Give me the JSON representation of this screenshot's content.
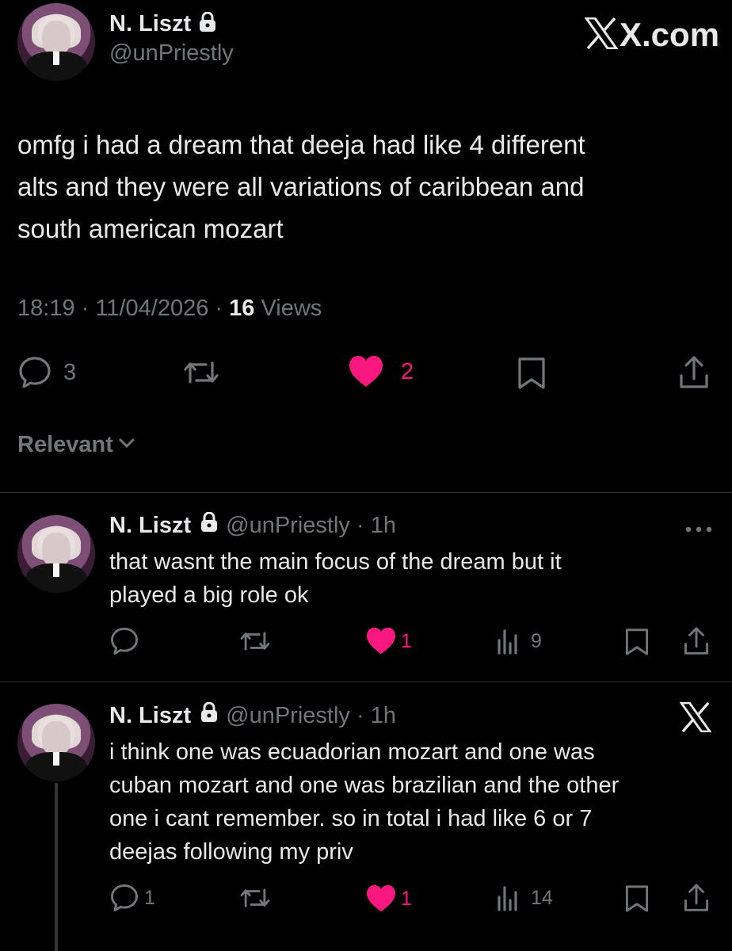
{
  "brand": {
    "site": "X.com"
  },
  "main_post": {
    "author_name": "N. Liszt",
    "handle": "@unPriestly",
    "text_lines": [
      "omfg i had a dream that deeja had like 4 different",
      "alts and they were all variations of caribbean and",
      "south american mozart"
    ],
    "time": "18:19",
    "date": "11/04/2026",
    "views_count": "16",
    "views_label": "Views",
    "replies": "3",
    "likes": "2"
  },
  "sort": {
    "label": "Relevant"
  },
  "replies": [
    {
      "author_name": "N. Liszt",
      "handle": "@unPriestly",
      "age": "1h",
      "text_lines": [
        "that wasnt the main focus of the dream but it",
        "played a big role ok"
      ],
      "replies": "",
      "likes": "1",
      "views": "9"
    },
    {
      "author_name": "N. Liszt",
      "handle": "@unPriestly",
      "age": "1h",
      "text_lines": [
        "i think one was ecuadorian mozart and one was",
        "cuban mozart and one was brazilian and the other",
        "one i cant remember. so in total i had like 6 or 7",
        "deejas following my priv"
      ],
      "replies": "1",
      "likes": "1",
      "views": "14"
    }
  ],
  "colors": {
    "like": "#f91880",
    "muted": "#71767b",
    "text": "#e7e9ea",
    "divider": "#2f3336"
  },
  "icons": [
    "lock-icon",
    "reply-icon",
    "retweet-icon",
    "heart-icon",
    "bookmark-icon",
    "share-icon",
    "views-icon",
    "more-icon",
    "x-logo-icon",
    "chevron-down-icon"
  ]
}
